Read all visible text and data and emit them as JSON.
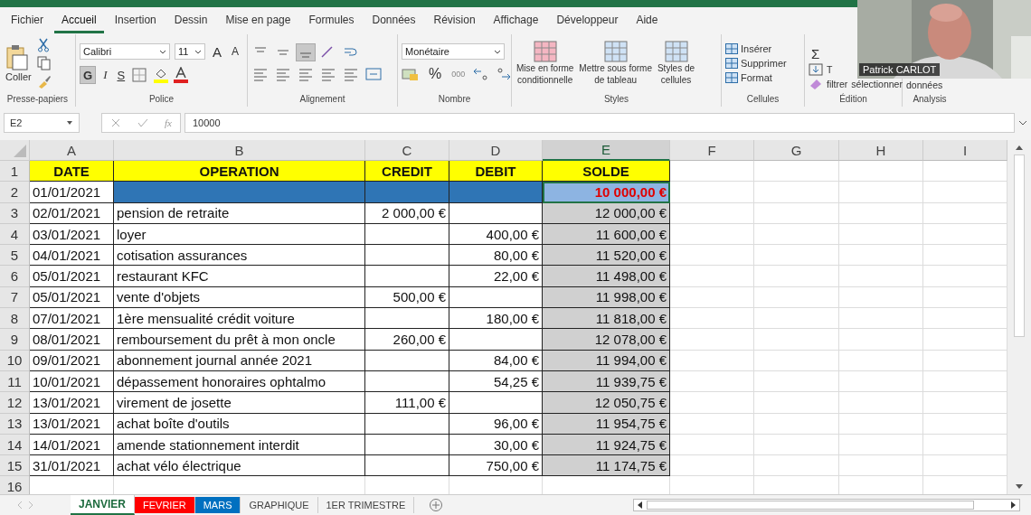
{
  "menu_tabs": [
    {
      "label": "Fichier",
      "selected": false
    },
    {
      "label": "Accueil",
      "selected": true
    },
    {
      "label": "Insertion",
      "selected": false
    },
    {
      "label": "Dessin",
      "selected": false
    },
    {
      "label": "Mise en page",
      "selected": false
    },
    {
      "label": "Formules",
      "selected": false
    },
    {
      "label": "Données",
      "selected": false
    },
    {
      "label": "Révision",
      "selected": false
    },
    {
      "label": "Affichage",
      "selected": false
    },
    {
      "label": "Développeur",
      "selected": false
    },
    {
      "label": "Aide",
      "selected": false
    }
  ],
  "ribbon": {
    "clipboard": {
      "paste": "Coller",
      "group": "Presse-papiers"
    },
    "font": {
      "name": "Calibri",
      "size": "11",
      "grow": "A",
      "shrink": "A",
      "bold": "G",
      "italic": "I",
      "underline": "S",
      "bold_pressed": true,
      "group": "Police"
    },
    "alignment": {
      "bottom_pressed": true,
      "group": "Alignement"
    },
    "number": {
      "format": "Monétaire",
      "percent": "%",
      "thousands": "000",
      "group": "Nombre"
    },
    "styles": {
      "buttons": [
        {
          "lines": [
            "Mise en forme",
            "conditionnelle"
          ]
        },
        {
          "lines": [
            "Mettre sous forme",
            "de tableau"
          ]
        },
        {
          "lines": [
            "Styles de",
            "cellules"
          ]
        }
      ],
      "group": "Styles"
    },
    "cells": {
      "buttons": [
        "Insérer",
        "Supprimer",
        "Format"
      ],
      "group": "Cellules"
    },
    "editing": {
      "sum": "Σ",
      "partial": "T",
      "filter": "filtrer",
      "select": "sélectionner",
      "group": "Édition"
    },
    "analysis": {
      "text": "données",
      "group": "Analysis"
    }
  },
  "formula_bar": {
    "name_box": "E2",
    "fx": "fx",
    "value": "10000"
  },
  "columns": [
    {
      "letter": "A",
      "heading": "DATE",
      "selected": false
    },
    {
      "letter": "B",
      "heading": "OPERATION",
      "selected": false
    },
    {
      "letter": "C",
      "heading": "CREDIT",
      "selected": false
    },
    {
      "letter": "D",
      "heading": "DEBIT",
      "selected": false
    },
    {
      "letter": "E",
      "heading": "SOLDE",
      "selected": true
    },
    {
      "letter": "F",
      "selected": false
    },
    {
      "letter": "G",
      "selected": false
    },
    {
      "letter": "H",
      "selected": false
    },
    {
      "letter": "I",
      "selected": false
    }
  ],
  "heading_row": "1",
  "rows": [
    {
      "num": "2",
      "date": "01/01/2021",
      "operation": "",
      "credit": "",
      "debit": "",
      "solde": "10 000,00 €",
      "highlighted": true,
      "selected": true
    },
    {
      "num": "3",
      "date": "02/01/2021",
      "operation": "pension de retraite",
      "credit": "2 000,00 €",
      "debit": "",
      "solde": "12 000,00 €",
      "highlighted": false,
      "selected": false
    },
    {
      "num": "4",
      "date": "03/01/2021",
      "operation": "loyer",
      "credit": "",
      "debit": "400,00 €",
      "solde": "11 600,00 €",
      "highlighted": false,
      "selected": false
    },
    {
      "num": "5",
      "date": "04/01/2021",
      "operation": "cotisation assurances",
      "credit": "",
      "debit": "80,00 €",
      "solde": "11 520,00 €",
      "highlighted": false,
      "selected": false
    },
    {
      "num": "6",
      "date": "05/01/2021",
      "operation": "restaurant KFC",
      "credit": "",
      "debit": "22,00 €",
      "solde": "11 498,00 €",
      "highlighted": false,
      "selected": false
    },
    {
      "num": "7",
      "date": "05/01/2021",
      "operation": "vente d'objets",
      "credit": "500,00 €",
      "debit": "",
      "solde": "11 998,00 €",
      "highlighted": false,
      "selected": false
    },
    {
      "num": "8",
      "date": "07/01/2021",
      "operation": "1ère mensualité crédit voiture",
      "credit": "",
      "debit": "180,00 €",
      "solde": "11 818,00 €",
      "highlighted": false,
      "selected": false
    },
    {
      "num": "9",
      "date": "08/01/2021",
      "operation": "remboursement du prêt à mon oncle",
      "credit": "260,00 €",
      "debit": "",
      "solde": "12 078,00 €",
      "highlighted": false,
      "selected": false
    },
    {
      "num": "10",
      "date": "09/01/2021",
      "operation": "abonnement journal année 2021",
      "credit": "",
      "debit": "84,00 €",
      "solde": "11 994,00 €",
      "highlighted": false,
      "selected": false
    },
    {
      "num": "11",
      "date": "10/01/2021",
      "operation": "dépassement honoraires ophtalmo",
      "credit": "",
      "debit": "54,25 €",
      "solde": "11 939,75 €",
      "highlighted": false,
      "selected": false
    },
    {
      "num": "12",
      "date": "13/01/2021",
      "operation": "virement de josette",
      "credit": "111,00 €",
      "debit": "",
      "solde": "12 050,75 €",
      "highlighted": false,
      "selected": false
    },
    {
      "num": "13",
      "date": "13/01/2021",
      "operation": "achat boîte d'outils",
      "credit": "",
      "debit": "96,00 €",
      "solde": "11 954,75 €",
      "highlighted": false,
      "selected": false
    },
    {
      "num": "14",
      "date": "14/01/2021",
      "operation": "amende stationnement interdit",
      "credit": "",
      "debit": "30,00 €",
      "solde": "11 924,75 €",
      "highlighted": false,
      "selected": false
    },
    {
      "num": "15",
      "date": "31/01/2021",
      "operation": "achat vélo électrique",
      "credit": "",
      "debit": "750,00 €",
      "solde": "11 174,75 €",
      "highlighted": false,
      "selected": false
    }
  ],
  "empty_rows": [
    "16"
  ],
  "sheet_tabs": [
    {
      "label": "JANVIER",
      "selected": true
    },
    {
      "label": "FEVRIER",
      "selected": false,
      "color": "#ff0000"
    },
    {
      "label": "MARS",
      "selected": false,
      "color": "#0070c0"
    },
    {
      "label": "GRAPHIQUE",
      "selected": false
    },
    {
      "label": "1ER TRIMESTRE",
      "selected": false
    }
  ],
  "webcam": {
    "name": "Patrick CARLOT"
  }
}
